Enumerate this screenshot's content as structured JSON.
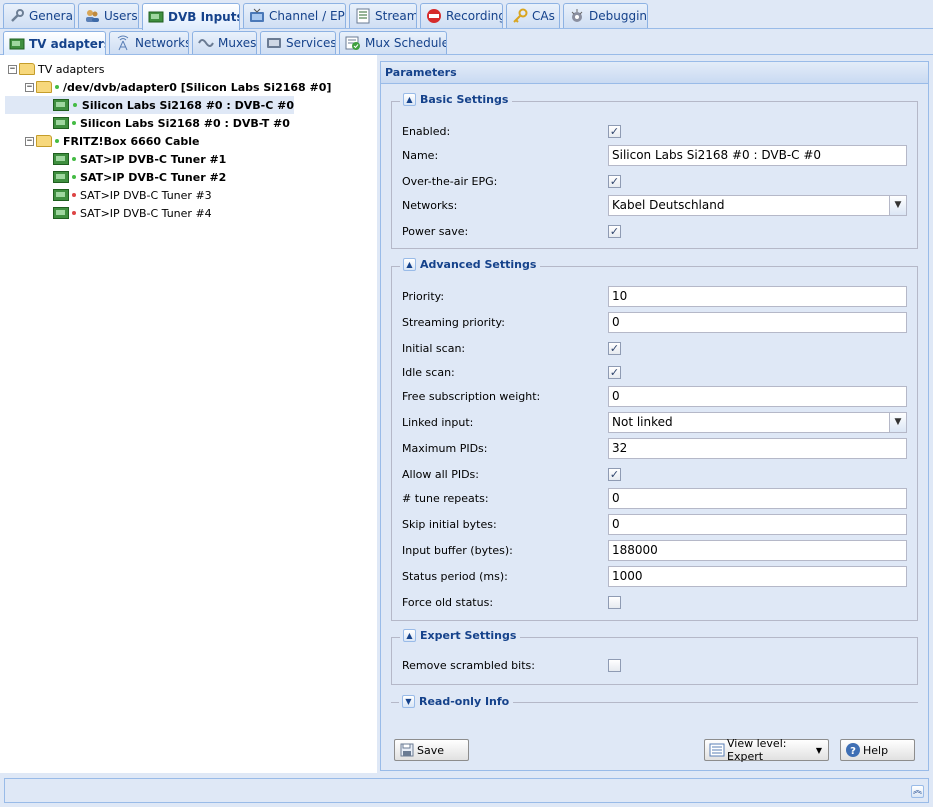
{
  "top_tabs": [
    {
      "label": "General",
      "icon": "wrench-icon"
    },
    {
      "label": "Users",
      "icon": "users-icon"
    },
    {
      "label": "DVB Inputs",
      "icon": "tv-card-icon"
    },
    {
      "label": "Channel / EPG",
      "icon": "tv-icon"
    },
    {
      "label": "Stream",
      "icon": "stream-icon"
    },
    {
      "label": "Recording",
      "icon": "rec-icon"
    },
    {
      "label": "CAs",
      "icon": "key-icon"
    },
    {
      "label": "Debugging",
      "icon": "bug-icon"
    }
  ],
  "sub_tabs": [
    {
      "label": "TV adapters",
      "icon": "tv-card-icon"
    },
    {
      "label": "Networks",
      "icon": "antenna-icon"
    },
    {
      "label": "Muxes",
      "icon": "mux-icon"
    },
    {
      "label": "Services",
      "icon": "services-icon"
    },
    {
      "label": "Mux Schedulers",
      "icon": "scheduler-icon"
    }
  ],
  "tree": {
    "root": "TV adapters",
    "nodes": [
      {
        "label": "/dev/dvb/adapter0 [Silicon Labs Si2168 #0]",
        "status": "green"
      },
      {
        "label": "Silicon Labs Si2168 #0 : DVB-C #0",
        "status": "green"
      },
      {
        "label": "Silicon Labs Si2168 #0 : DVB-T #0",
        "status": "green"
      },
      {
        "label": "FRITZ!Box 6660 Cable",
        "status": "green"
      },
      {
        "label": "SAT>IP DVB-C Tuner #1",
        "status": "green"
      },
      {
        "label": "SAT>IP DVB-C Tuner #2",
        "status": "green"
      },
      {
        "label": "SAT>IP DVB-C Tuner #3",
        "status": "red"
      },
      {
        "label": "SAT>IP DVB-C Tuner #4",
        "status": "red"
      }
    ]
  },
  "colors": {
    "status_green": "#44bb44",
    "status_red": "#dd4444",
    "accent": "#15428b"
  },
  "params": {
    "title": "Parameters",
    "basic": {
      "legend": "Basic Settings",
      "enabled_label": "Enabled:",
      "enabled": true,
      "name_label": "Name:",
      "name_value": "Silicon Labs Si2168 #0 : DVB-C #0",
      "epg_label": "Over-the-air EPG:",
      "epg": true,
      "networks_label": "Networks:",
      "networks_value": "Kabel Deutschland",
      "power_label": "Power save:",
      "power": true
    },
    "advanced": {
      "legend": "Advanced Settings",
      "priority_label": "Priority:",
      "priority_value": "10",
      "stream_prio_label": "Streaming priority:",
      "stream_prio_value": "0",
      "initial_scan_label": "Initial scan:",
      "initial_scan": true,
      "idle_scan_label": "Idle scan:",
      "idle_scan": true,
      "free_sub_label": "Free subscription weight:",
      "free_sub_value": "0",
      "linked_label": "Linked input:",
      "linked_value": "Not linked",
      "max_pids_label": "Maximum PIDs:",
      "max_pids_value": "32",
      "allow_pids_label": "Allow all PIDs:",
      "allow_pids": true,
      "tune_label": "# tune repeats:",
      "tune_value": "0",
      "skip_label": "Skip initial bytes:",
      "skip_value": "0",
      "buffer_label": "Input buffer (bytes):",
      "buffer_value": "188000",
      "status_period_label": "Status period (ms):",
      "status_period_value": "1000",
      "force_label": "Force old status:",
      "force": false
    },
    "expert": {
      "legend": "Expert Settings",
      "scrambled_label": "Remove scrambled bits:",
      "scrambled": false
    },
    "readonly": {
      "legend": "Read-only Info"
    }
  },
  "buttons": {
    "save": "Save",
    "view_level": "View level: Expert",
    "help": "Help"
  }
}
